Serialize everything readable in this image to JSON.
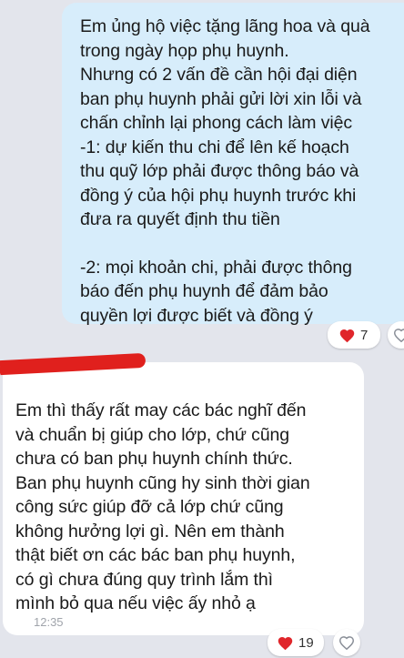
{
  "outgoing_message": {
    "lines": [
      "Em ủng hộ việc tặng lãng hoa và quà",
      "trong ngày họp phụ huynh.",
      "Nhưng có 2 vấn đề cần hội đại diện",
      "ban phụ huynh phải gửi lời xin lỗi và",
      "chấn chỉnh lại phong cách làm việc",
      "-1: dự kiến thu chi để lên kế hoạch",
      "thu quỹ lớp phải được thông báo và",
      "đồng ý của hội phụ huynh trước khi",
      "đưa ra quyết định thu tiền",
      "",
      "-2: mọi khoản chi, phải được thông",
      "báo đến phụ huynh để đảm bảo",
      "quyền lợi được biết và đồng ý"
    ],
    "reaction_count": "7",
    "reaction_icon": "heart-icon",
    "like_icon": "heart-outline-icon"
  },
  "incoming_message": {
    "lines": [
      "Em thì thấy rất may các bác nghĩ đến",
      "và chuẩn bị giúp cho lớp, chứ cũng",
      "chưa có ban phụ huynh chính thức.",
      "Ban phụ huynh cũng hy sinh thời gian",
      "công sức giúp đỡ cả lớp chứ cũng",
      "không hưởng lợi gì. Nên em thành",
      "thật biết ơn các bác ban phụ huynh,",
      "có gì chưa đúng quy trình lắm thì",
      "mình bỏ qua nếu việc ấy nhỏ ạ"
    ],
    "time": "12:35",
    "reaction_count": "19",
    "reaction_icon": "heart-icon",
    "like_icon": "heart-outline-icon"
  },
  "colors": {
    "background": "#e3e5ec",
    "outgoing_bubble": "#d7edfb",
    "incoming_bubble": "#ffffff",
    "heart": "#e0262b",
    "redaction": "#e0201d"
  }
}
